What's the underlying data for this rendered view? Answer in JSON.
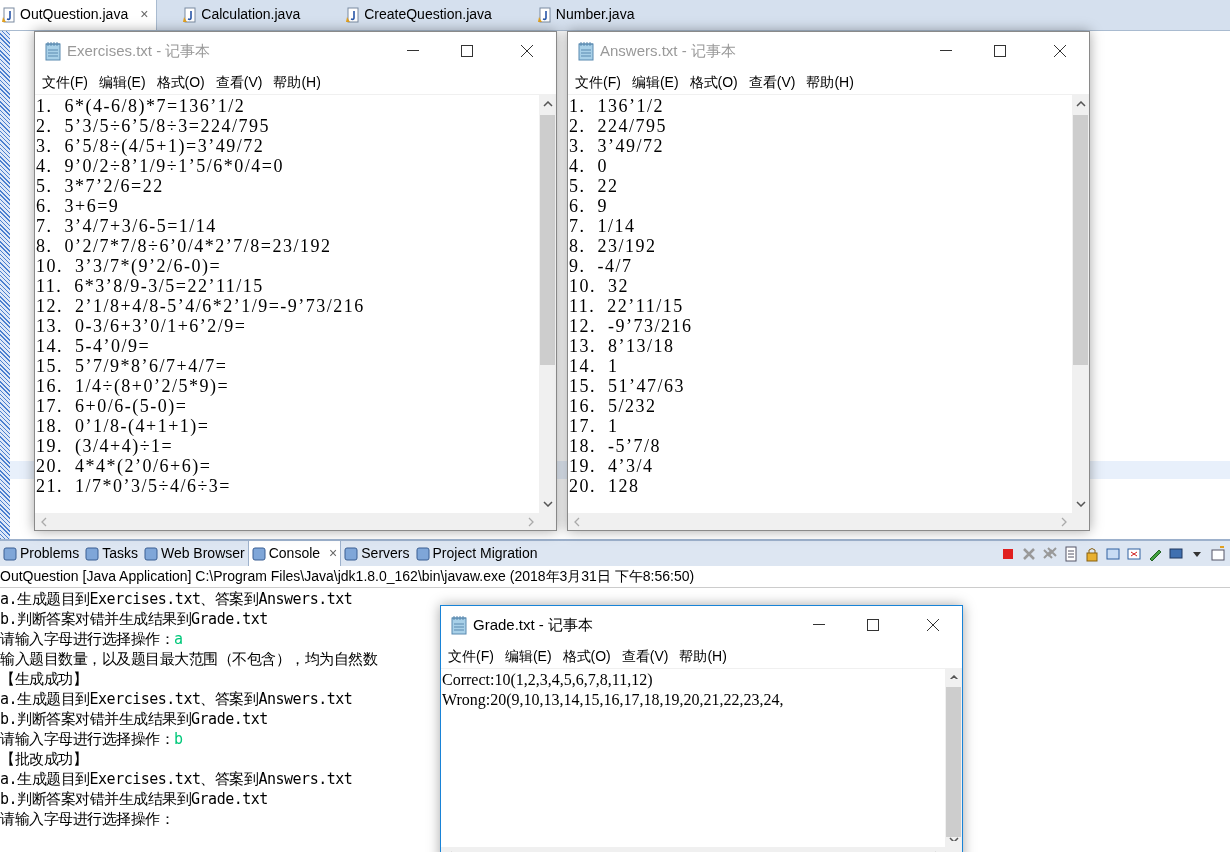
{
  "editor_tabs": [
    {
      "label": "OutQuestion.java",
      "selected": true,
      "close": "×"
    },
    {
      "label": "Calculation.java",
      "selected": false
    },
    {
      "label": "CreateQuestion.java",
      "selected": false
    },
    {
      "label": "Number.java",
      "selected": false
    }
  ],
  "notepads": [
    {
      "title": "Exercises.txt - 记事本",
      "focused": false,
      "menu": [
        "文件(F)",
        "编辑(E)",
        "格式(O)",
        "查看(V)",
        "帮助(H)"
      ],
      "lines": [
        "1.  6*(4-6/8)*7=136’1/2",
        "2.  5’3/5÷6’5/8÷3=224/795",
        "3.  6’5/8÷(4/5+1)=3’49/72",
        "4.  9’0/2÷8’1/9÷1’5/6*0/4=0",
        "5.  3*7’2/6=22",
        "6.  3+6=9",
        "7.  3’4/7+3/6-5=1/14",
        "8.  0’2/7*7/8÷6’0/4*2’7/8=23/192",
        "10.  3’3/7*(9’2/6-0)=",
        "11.  6*3’8/9-3/5=22’11/15",
        "12.  2’1/8+4/8-5’4/6*2’1/9=-9’73/216",
        "13.  0-3/6+3’0/1+6’2/9=",
        "14.  5-4’0/9=",
        "15.  5’7/9*8’6/7+4/7=",
        "16.  1/4÷(8+0’2/5*9)=",
        "17.  6+0/6-(5-0)=",
        "18.  0’1/8-(4+1+1)=",
        "19.  (3/4+4)÷1=",
        "20.  4*4*(2’0/6+6)=",
        "21.  1/7*0’3/5÷4/6÷3="
      ]
    },
    {
      "title": "Answers.txt - 记事本",
      "focused": false,
      "menu": [
        "文件(F)",
        "编辑(E)",
        "格式(O)",
        "查看(V)",
        "帮助(H)"
      ],
      "lines": [
        "1.  136’1/2",
        "2.  224/795",
        "3.  3’49/72",
        "4.  0",
        "5.  22",
        "6.  9",
        "7.  1/14",
        "8.  23/192",
        "9.  -4/7",
        "10.  32",
        "11.  22’11/15",
        "12.  -9’73/216",
        "13.  8’13/18",
        "14.  1",
        "15.  51’47/63",
        "16.  5/232",
        "17.  1",
        "18.  -5’7/8",
        "19.  4’3/4",
        "20.  128"
      ]
    },
    {
      "title": "Grade.txt - 记事本",
      "focused": true,
      "menu": [
        "文件(F)",
        "编辑(E)",
        "格式(O)",
        "查看(V)",
        "帮助(H)"
      ],
      "lines": [
        "Correct:10(1,2,3,4,5,6,7,8,11,12)",
        "Wrong:20(9,10,13,14,15,16,17,18,19,20,21,22,23,24,"
      ]
    }
  ],
  "console": {
    "tabs": [
      {
        "label": "Problems",
        "selected": false
      },
      {
        "label": "Tasks",
        "selected": false
      },
      {
        "label": "Web Browser",
        "selected": false
      },
      {
        "label": "Console",
        "selected": true,
        "close": "×"
      },
      {
        "label": "Servers",
        "selected": false
      },
      {
        "label": "Project Migration",
        "selected": false
      }
    ],
    "launch": "OutQuestion [Java Application] C:\\Program Files\\Java\\jdk1.8.0_162\\bin\\javaw.exe (2018年3月31日 下午8:56:50)",
    "lines": [
      {
        "text": "a.生成题目到Exercises.txt、答案到Answers.txt"
      },
      {
        "text": "b.判断答案对错并生成结果到Grade.txt"
      },
      {
        "text": "请输入字母进行选择操作：",
        "input": "a"
      },
      {
        "text": "输入题目数量，以及题目最大范围（不包含），均为自然数"
      },
      {
        "text": "【生成成功】"
      },
      {
        "text": "a.生成题目到Exercises.txt、答案到Answers.txt"
      },
      {
        "text": "b.判断答案对错并生成结果到Grade.txt"
      },
      {
        "text": "请输入字母进行选择操作：",
        "input": "b"
      },
      {
        "text": "【批改成功】"
      },
      {
        "text": "a.生成题目到Exercises.txt、答案到Answers.txt"
      },
      {
        "text": "b.判断答案对错并生成结果到Grade.txt"
      },
      {
        "text": "请输入字母进行选择操作："
      }
    ]
  }
}
